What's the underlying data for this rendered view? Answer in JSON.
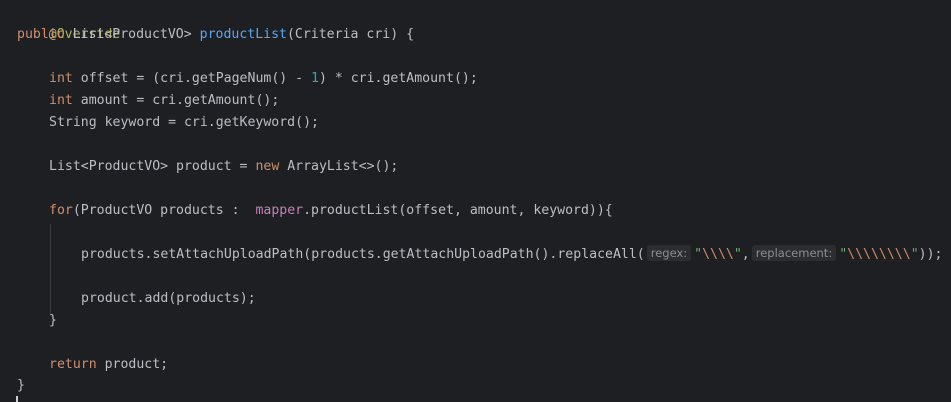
{
  "code": {
    "annotation": "@Override",
    "sig": {
      "kw": "public",
      "type": "List<ProductVO>",
      "name": "productList",
      "params": "(Criteria cri) {"
    },
    "offset": {
      "kw": "int",
      "pre": " offset = (cri.getPageNum() - ",
      "num": "1",
      "post": ") * cri.getAmount();"
    },
    "amount": {
      "kw": "int",
      "rest": " amount = cri.getAmount();"
    },
    "keyword_line": "String keyword = cri.getKeyword();",
    "list_decl": {
      "pre": "List<ProductVO> product = ",
      "kw": "new",
      "post": " ArrayList<>();"
    },
    "for_line": {
      "kw": "for",
      "mid": "(ProductVO products :  ",
      "field": "mapper",
      "post": ".productList(offset, amount, keyword)){"
    },
    "set_line": {
      "pre": "products.setAttachUploadPath(products.getAttachUploadPath().replaceAll(",
      "hint1": "regex:",
      "q1": "\"",
      "esc1": "\\\\\\\\",
      "q1b": "\"",
      "comma": ",",
      "hint2": "replacement:",
      "q2": "\"",
      "esc2": "\\\\\\\\\\\\\\\\",
      "q2b": "\"",
      "post": "));"
    },
    "add_line": "product.add(products);",
    "close_for": "}",
    "ret": {
      "kw": "return",
      "rest": " product;"
    },
    "close_method": "}"
  }
}
